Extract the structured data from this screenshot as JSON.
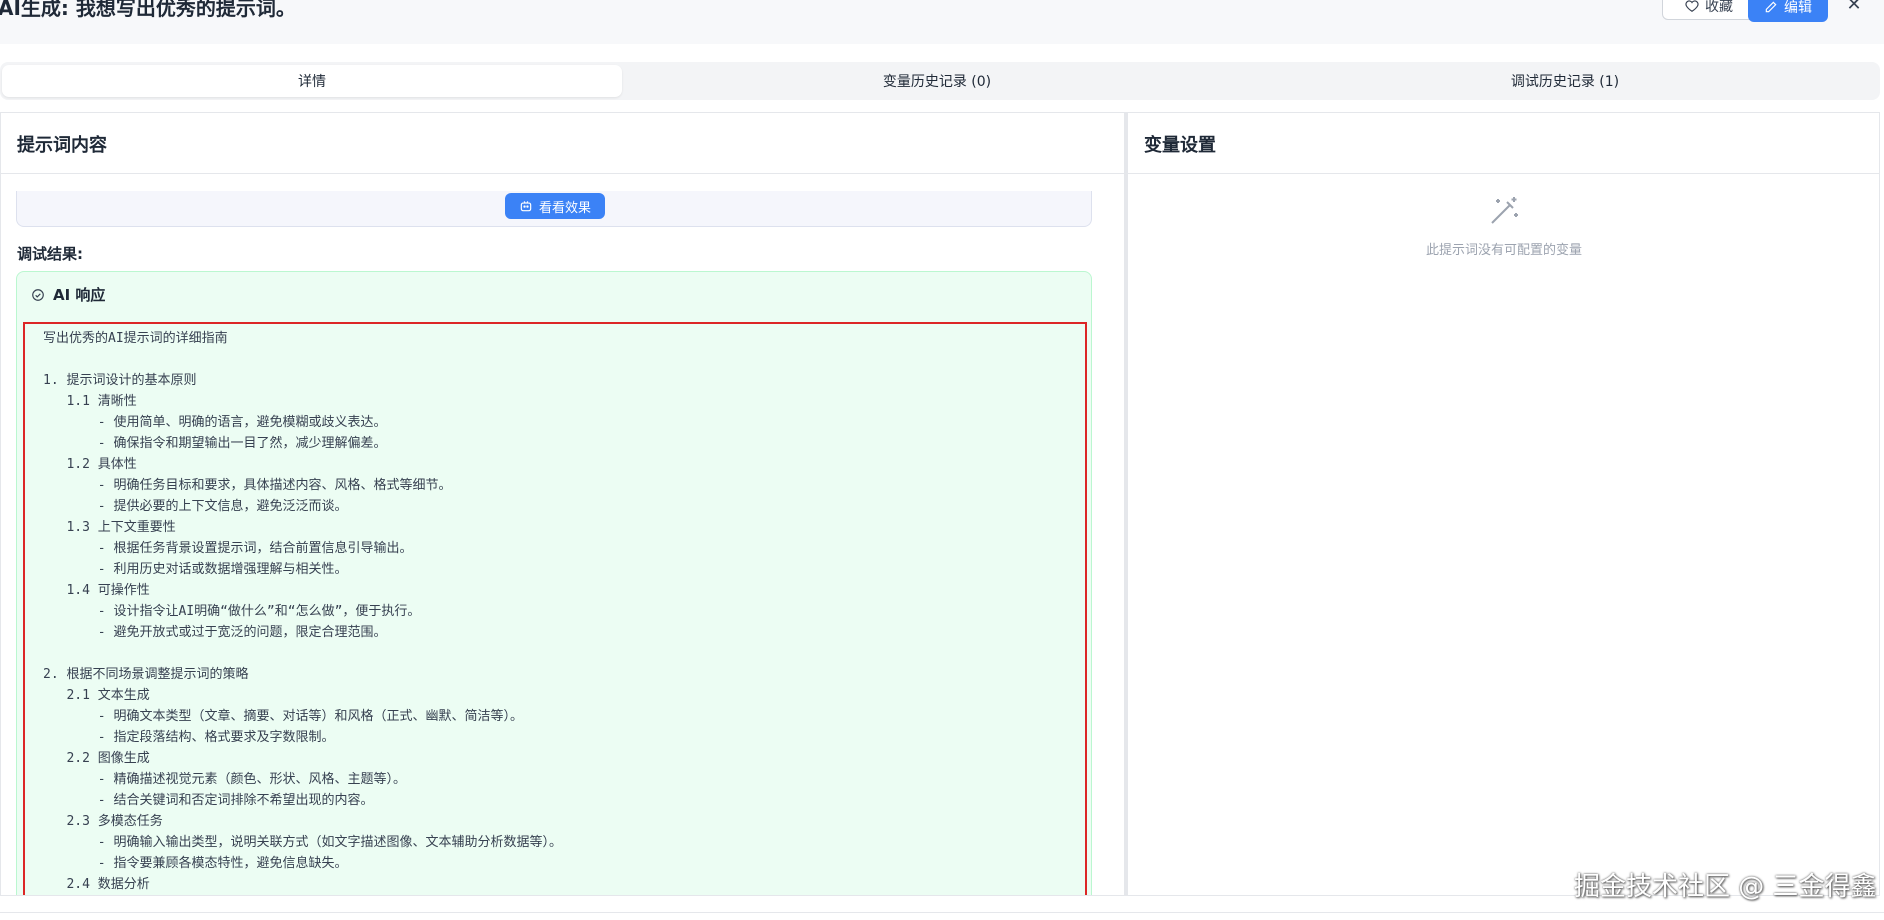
{
  "header": {
    "title": "AI生成: 我想写出优秀的提示词。",
    "favorite_label": "收藏",
    "edit_label": "编辑",
    "close_symbol": "✕"
  },
  "tabs": [
    {
      "label": "详情",
      "active": true
    },
    {
      "label": "变量历史记录 (0)",
      "active": false
    },
    {
      "label": "调试历史记录 (1)",
      "active": false
    }
  ],
  "left_panel": {
    "title": "提示词内容",
    "preview_button": "看看效果",
    "debug_label": "调试结果:",
    "response_title": "AI 响应",
    "response_lines": [
      "写出优秀的AI提示词的详细指南",
      "",
      "1. 提示词设计的基本原则",
      "   1.1 清晰性",
      "       - 使用简单、明确的语言，避免模糊或歧义表达。",
      "       - 确保指令和期望输出一目了然，减少理解偏差。",
      "   1.2 具体性",
      "       - 明确任务目标和要求，具体描述内容、风格、格式等细节。",
      "       - 提供必要的上下文信息，避免泛泛而谈。",
      "   1.3 上下文重要性",
      "       - 根据任务背景设置提示词，结合前置信息引导输出。",
      "       - 利用历史对话或数据增强理解与相关性。",
      "   1.4 可操作性",
      "       - 设计指令让AI明确“做什么”和“怎么做”，便于执行。",
      "       - 避免开放式或过于宽泛的问题，限定合理范围。",
      "",
      "2. 根据不同场景调整提示词的策略",
      "   2.1 文本生成",
      "       - 明确文本类型（文章、摘要、对话等）和风格（正式、幽默、简洁等）。",
      "       - 指定段落结构、格式要求及字数限制。",
      "   2.2 图像生成",
      "       - 精确描述视觉元素（颜色、形状、风格、主题等）。",
      "       - 结合关键词和否定词排除不希望出现的内容。",
      "   2.3 多模态任务",
      "       - 明确输入输出类型，说明关联方式（如文字描述图像、文本辅助分析数据等）。",
      "       - 指令要兼顾各模态特性，避免信息缺失。",
      "   2.4 数据分析"
    ]
  },
  "right_panel": {
    "title": "变量设置",
    "empty_text": "此提示词没有可配置的变量"
  },
  "watermark": "掘金技术社区 @ 三金得鑫",
  "colors": {
    "primary": "#3b82f6",
    "response_bg": "#ecfdf3",
    "highlight_border": "#dc2626"
  }
}
